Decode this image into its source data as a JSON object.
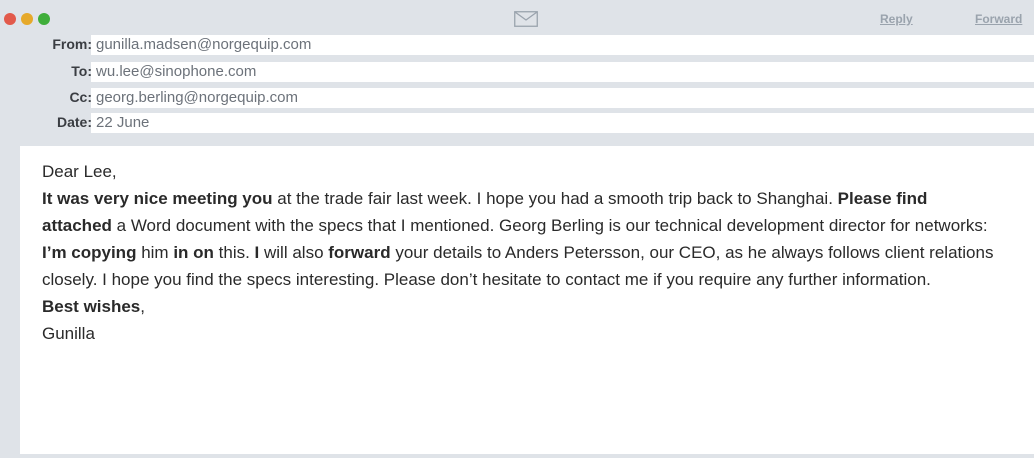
{
  "toolbar": {
    "reply_label": "Reply",
    "forward_label": "Forward",
    "mail_icon": "envelope-icon"
  },
  "header": {
    "from_label": "From:",
    "from_value": "gunilla.madsen@norgequip.com",
    "to_label": "To:",
    "to_value": "wu.lee@sinophone.com",
    "cc_label": "Cc:",
    "cc_value": "georg.berling@norgequip.com",
    "date_label": "Date:",
    "date_value": "22 June"
  },
  "message": {
    "greeting": "Dear Lee,",
    "p1_b1": "It was very nice meeting you",
    "p1_t1": " at the trade fair last week. I hope you had a smooth trip back to Shanghai. ",
    "p1_b2": "Please find attached",
    "p1_t2": " a Word document with the specs that I mentioned. Georg Berling is our technical development director for networks: ",
    "p1_b3": "I’m copying",
    "p1_t3": " him ",
    "p1_b4": "in on",
    "p1_t4": " this. ",
    "p1_b5": "I",
    "p1_t5": " will also ",
    "p1_b6": "forward",
    "p1_t6": " your details to Anders Petersson, our CEO, as he always follows client relations closely. I hope you find the specs interesting. Please don’t hesitate to contact me if you require any further information.",
    "closing_bold": "Best wishes",
    "closing_comma": ",",
    "signature": "Gunilla"
  },
  "colors": {
    "window_bg": "#dfe3e8",
    "close": "#e25a4b",
    "minimize": "#e6a92a",
    "zoom": "#3fae3a"
  }
}
